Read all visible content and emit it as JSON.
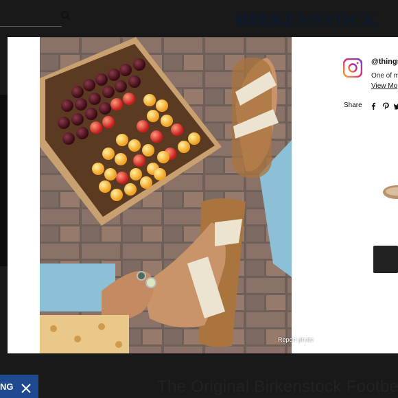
{
  "brand": "BIRKENSTOCK",
  "page_heading": "The Original Birkenstock Footbe",
  "promo": {
    "label": "NG"
  },
  "modal": {
    "instagram": {
      "handle": "@things",
      "description": "One of m",
      "link": "View Mo"
    },
    "share": {
      "label": "Share"
    },
    "report_photo": "Report photo"
  },
  "colors": {
    "promo_bg": "#1f4a8f",
    "brand_text": "#0d1a2e",
    "overlay": "#191919"
  }
}
